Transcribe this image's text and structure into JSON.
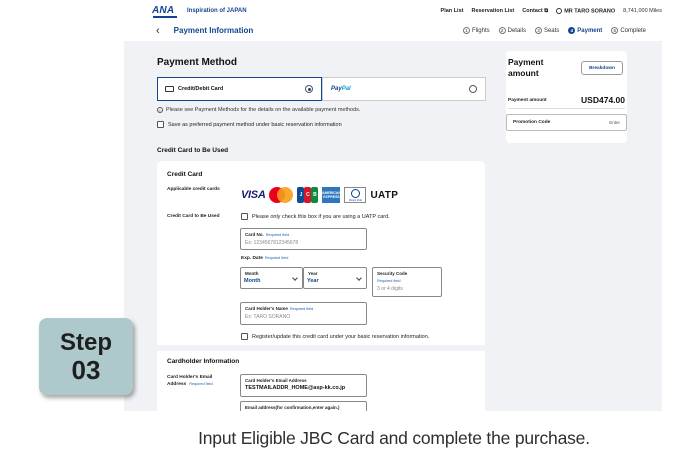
{
  "header": {
    "logo": "ANA",
    "tagline": "Inspiration of JAPAN",
    "links": [
      "Plan List",
      "Reservation List",
      "Contact"
    ],
    "user": "MR TARO SORANO",
    "miles": "8,741,000 Miles"
  },
  "subheader": {
    "back": "‹",
    "title": "Payment Information",
    "steps": [
      {
        "num": "1",
        "label": "Flights"
      },
      {
        "num": "2",
        "label": "Details"
      },
      {
        "num": "3",
        "label": "Seats"
      },
      {
        "num": "4",
        "label": "Payment"
      },
      {
        "num": "5",
        "label": "Complete"
      }
    ],
    "active_step": 4
  },
  "payment_method": {
    "heading": "Payment Method",
    "credit_option": "Credit/Debit Card",
    "paypal_option_a": "Pay",
    "paypal_option_b": "Pal",
    "info": "Please see Payment Methods for the details on the available payment methods.",
    "save_preferred": "Save as preferred payment method under basic reservation information"
  },
  "credit_card_section": {
    "heading": "Credit Card to Be Used",
    "panel_heading": "Credit Card",
    "applicable_label": "Applicable credit cards",
    "brands": {
      "visa": "VISA",
      "jcb": [
        "J",
        "C",
        "B"
      ],
      "amex": "AMERICAN EXPRESS",
      "diners": "Diners Club",
      "uatp": "UATP"
    },
    "card_label": "Credit Card to Be Used",
    "uatp_check": "Please only check this box if you are using a UATP card.",
    "card_no_label": "Card No.",
    "required": "Required field",
    "card_no_placeholder": "Ex: 1234567812345678",
    "exp_label": "Exp. Date",
    "month_label": "Month",
    "month_value": "Month",
    "year_label": "Year",
    "year_value": "Year",
    "security_label": "Security Code",
    "security_placeholder": "3 or 4 digits",
    "holder_label": "Card Holder's Name",
    "holder_placeholder": "Ex: TARO SORANO",
    "register_check": "Register/update this credit card under your basic reservation information."
  },
  "cardholder_section": {
    "heading": "Cardholder Information",
    "email_label_1": "Card Holder's Email",
    "email_label_2": "Address",
    "email_field_label": "Card Holder's Email Address",
    "email_value": "TESTMAILADDR_HOME@asp-kk.co.jp",
    "confirm_label": "Email address(for confirmation,enter again.)"
  },
  "summary": {
    "title": "Payment amount",
    "breakdown": "Breakdown",
    "amount_label": "Payment amount",
    "amount": "USD474.00",
    "promo_label": "Promotion Code",
    "promo_enter": "Enter"
  },
  "badge": {
    "word": "Step",
    "number": "03"
  },
  "caption": "Input Eligible JBC Card and complete the purchase.",
  "colors": {
    "brand": "#13448f",
    "badge": "#aec9cc",
    "content_bg": "#f1f2f5"
  }
}
